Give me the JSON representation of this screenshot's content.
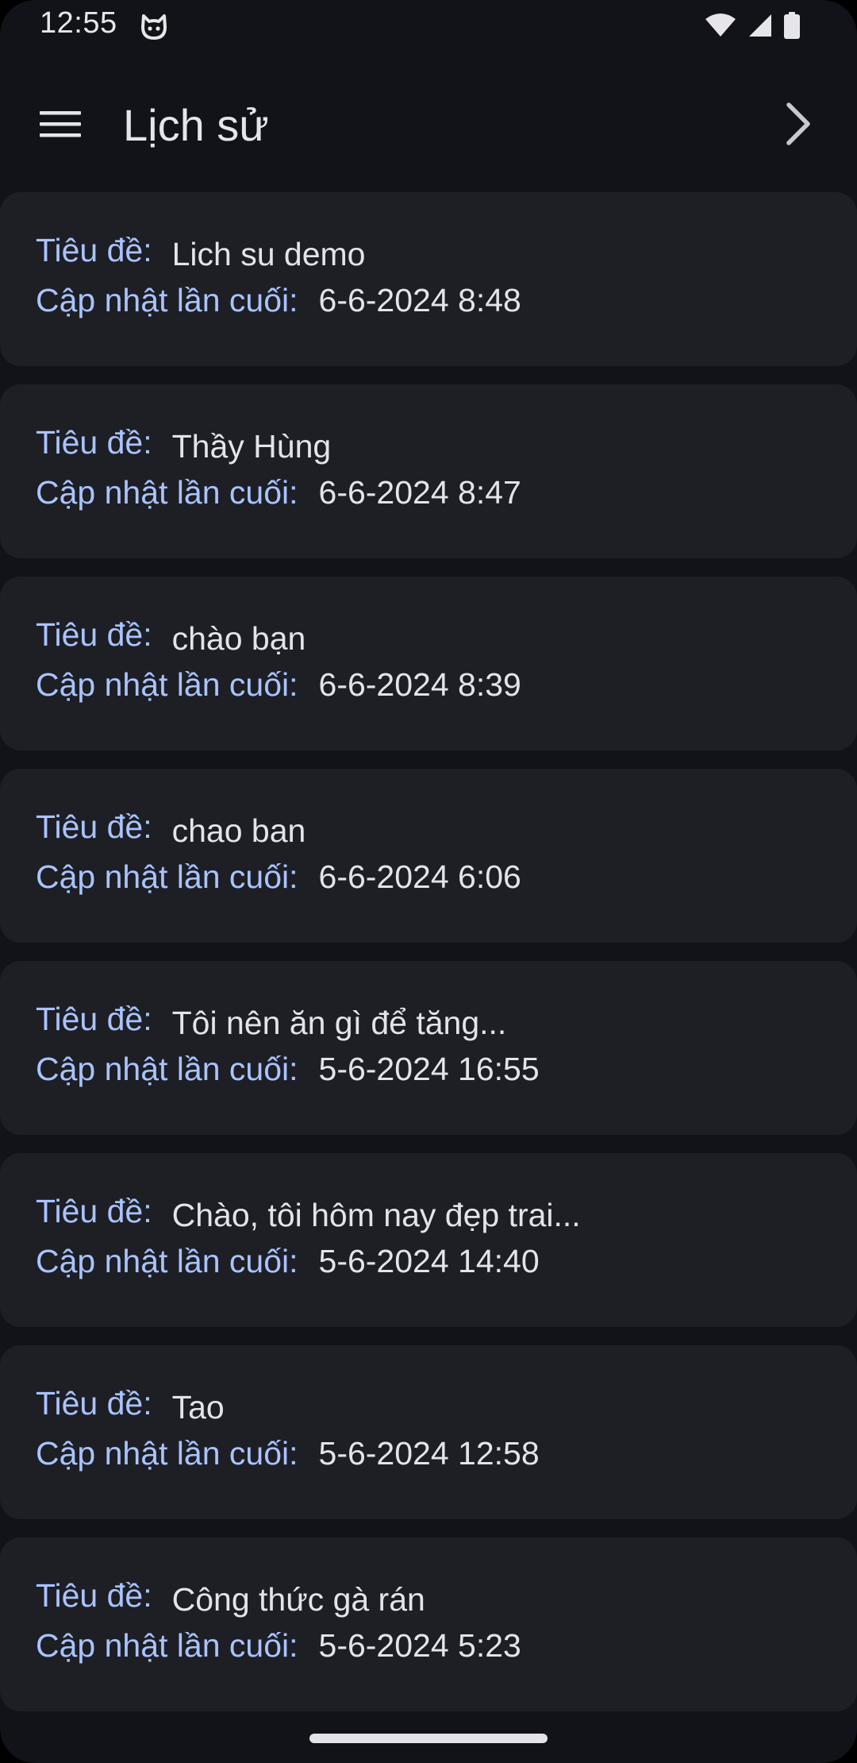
{
  "status_bar": {
    "time": "12:55",
    "icons": [
      "cat-app-icon",
      "wifi-icon",
      "signal-icon",
      "battery-icon"
    ]
  },
  "app_bar": {
    "title": "Lịch sử",
    "menu_icon": "hamburger-menu-icon",
    "next_icon": "chevron-right-icon"
  },
  "labels": {
    "title": "Tiêu đề:",
    "updated": "Cập nhật lần cuối:"
  },
  "history": [
    {
      "title": "Lich su demo",
      "updated": "6-6-2024 8:48"
    },
    {
      "title": "Thầy Hùng",
      "updated": "6-6-2024 8:47"
    },
    {
      "title": "chào bạn",
      "updated": "6-6-2024 8:39"
    },
    {
      "title": "chao ban",
      "updated": "6-6-2024 6:06"
    },
    {
      "title": "Tôi nên ăn gì để tăng...",
      "updated": "5-6-2024 16:55"
    },
    {
      "title": "Chào, tôi hôm nay đẹp trai...",
      "updated": "5-6-2024 14:40"
    },
    {
      "title": "Tao",
      "updated": "5-6-2024 12:58"
    },
    {
      "title": "Công thức gà rán",
      "updated": "5-6-2024 5:23"
    }
  ],
  "colors": {
    "background": "#111318",
    "card": "#1d1f25",
    "label_accent": "#aac3ff",
    "text": "#e3e4e9"
  }
}
